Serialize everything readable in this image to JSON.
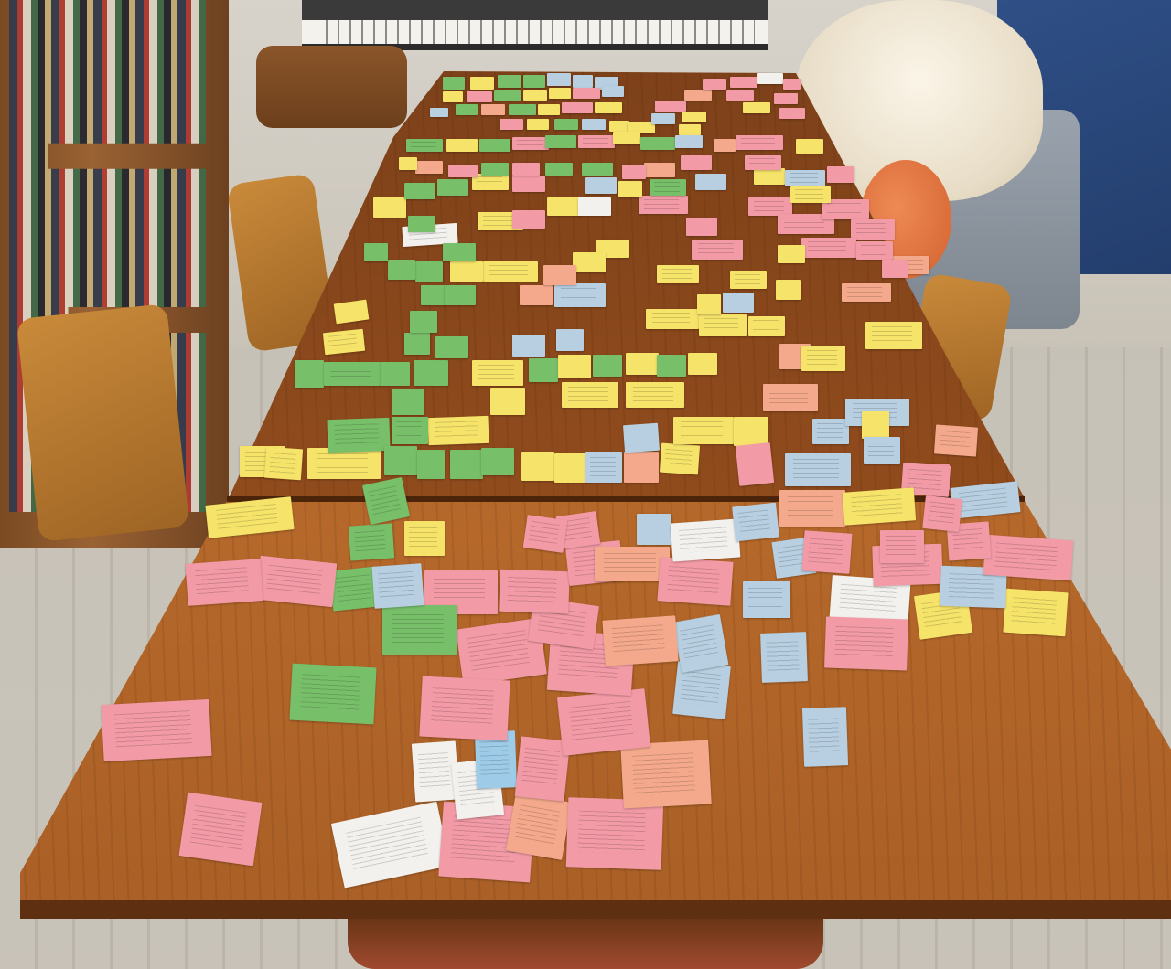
{
  "photo": {
    "description_text": "",
    "colors": {
      "pink": "#f29aa6",
      "salmon": "#f4a98c",
      "yellow": "#f5e36a",
      "green": "#78bf6a",
      "blue": "#9ecbe8",
      "light_blue": "#b7cfe0",
      "white": "#f3f1ee",
      "orange_peach": "#f7b98f"
    }
  }
}
